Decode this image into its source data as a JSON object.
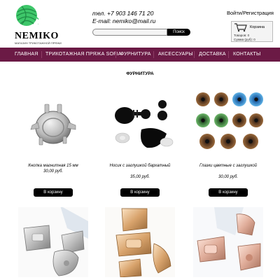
{
  "header": {
    "logo_text": "NEMIKO",
    "logo_sub": "МАГАЗИН ТРИКОТАЖНОЙ ПРЯЖИ",
    "phone": "тел. +7 903 146 71 20",
    "email": "E-mail: nemiko@mail.ru",
    "search": {
      "placeholder": "",
      "button_label": "Поиск"
    },
    "login_label": "Войти/Регистрация",
    "cart": {
      "title": "Корзина",
      "items_label": "Товаров: 0",
      "sum_label": "Сумма (руб): 0"
    }
  },
  "nav": {
    "items": [
      {
        "label": "ГЛАВНАЯ"
      },
      {
        "label": "ТРИКОТАЖНАЯ ПРЯЖА SOFIA"
      },
      {
        "label": "ФУРНИТУРА"
      },
      {
        "label": "АКСЕССУАРЫ"
      },
      {
        "label": "ДОСТАВКА"
      },
      {
        "label": "КОНТАКТЫ"
      }
    ]
  },
  "main": {
    "title": "ФУРНИТУРА",
    "products": [
      {
        "name": "Кнопка магнитная 15 мм",
        "price": "30,00 руб.",
        "button": "В корзину",
        "icon": "magnetic-button"
      },
      {
        "name": "Носик с заглушкой бархатный",
        "price": "35,00 руб.",
        "button": "В корзину",
        "icon": "toy-nose"
      },
      {
        "name": "Глазки цветные с заглушкой",
        "price": "30,00 руб.",
        "button": "В корзину",
        "icon": "toy-eyes"
      },
      {
        "name": "",
        "price": "",
        "button": "",
        "icon": "silver-clasp"
      },
      {
        "name": "",
        "price": "",
        "button": "",
        "icon": "gold-clasp"
      },
      {
        "name": "",
        "price": "",
        "button": "",
        "icon": "rose-gold-clasp"
      }
    ]
  },
  "colors": {
    "nav_bg": "#6b1a45",
    "logo_green": "#3ec76a",
    "button_bg": "#000000"
  }
}
